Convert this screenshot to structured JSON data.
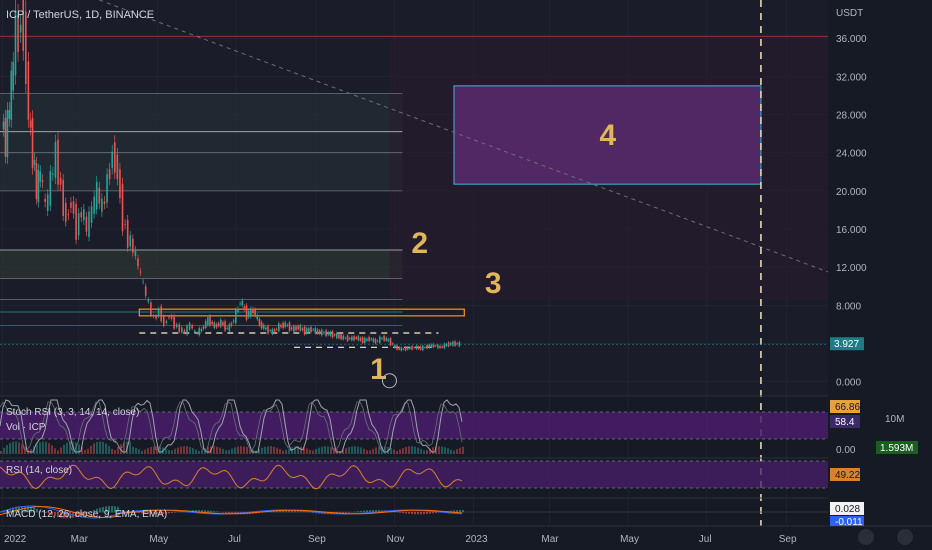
{
  "header": {
    "symbol_title": "ICP / TetherUS, 1D, BINANCE",
    "currency": "USDT"
  },
  "chart_data": [
    {
      "type": "line",
      "title": "ICP / TetherUS, 1D, BINANCE",
      "y_axis_unit": "USDT",
      "ylim": [
        -1.5,
        40
      ],
      "y_ticks": [
        "36.000",
        "32.000",
        "28.000",
        "24.000",
        "20.000",
        "16.000",
        "12.000",
        "8.000",
        "4.000",
        "0.000"
      ],
      "y_tick_values": [
        36,
        32,
        28,
        24,
        20,
        16,
        12,
        8,
        4,
        0
      ],
      "x_ticks": [
        "2022",
        "Mar",
        "May",
        "Jul",
        "Sep",
        "Nov",
        "2023",
        "Mar",
        "May",
        "Jul",
        "Sep"
      ],
      "x_tick_days": [
        0,
        59,
        120,
        181,
        243,
        304,
        365,
        424,
        485,
        546,
        608
      ],
      "xlim_days": [
        -2,
        640
      ],
      "last_price": "3.927",
      "last_price_value": 3.927,
      "price_series": {
        "x_days": [
          0,
          3,
          6,
          9,
          11,
          13,
          15,
          17,
          19,
          21,
          24,
          27,
          30,
          34,
          38,
          42,
          46,
          50,
          54,
          58,
          62,
          66,
          70,
          74,
          78,
          82,
          86,
          90,
          94,
          98,
          102,
          106,
          110,
          114,
          118,
          122,
          126,
          130,
          134,
          138,
          142,
          146,
          150,
          155,
          160,
          165,
          170,
          175,
          180,
          185,
          190,
          195,
          200,
          205,
          210,
          215,
          220,
          225,
          230,
          235,
          240,
          245,
          250,
          255,
          260,
          265,
          270,
          275,
          280,
          285,
          290,
          295,
          300,
          305,
          310,
          315,
          320,
          325,
          330,
          335,
          340,
          345,
          350,
          355
        ],
        "y": [
          27.5,
          25,
          29,
          33,
          38,
          35,
          39,
          37,
          33,
          28,
          24,
          20,
          22,
          18,
          21,
          24,
          20,
          17,
          19,
          16,
          18,
          16,
          18,
          20,
          18,
          21,
          24,
          22,
          17,
          15,
          14,
          12,
          10,
          8,
          6.5,
          7.5,
          6,
          7,
          6,
          5.5,
          5.2,
          6,
          5,
          5.5,
          6.5,
          5.8,
          6.2,
          5.5,
          6.5,
          8.5,
          7,
          7.5,
          6,
          5.5,
          5.2,
          5.8,
          6,
          5.5,
          5.7,
          5.3,
          5.5,
          5.2,
          5.1,
          5,
          4.8,
          4.6,
          4.5,
          4.6,
          4.3,
          4.5,
          4.2,
          4.6,
          4.3,
          3.6,
          3.4,
          3.5,
          3.6,
          3.5,
          3.7,
          3.8,
          3.6,
          3.9,
          4.0,
          3.93
        ]
      },
      "horizontal_levels": [
        36.2,
        30.2,
        26.2,
        24.0,
        20.0,
        13.8,
        10.8,
        8.6,
        7.3,
        5.9
      ],
      "trendline_points": [
        {
          "x_day": 75,
          "y": 40
        },
        {
          "x_day": 640,
          "y": 11.5
        }
      ],
      "projection_line_x_day": 588,
      "zones": [
        {
          "label": "4",
          "x1_day": 350,
          "x2_day": 588,
          "y1": 20.7,
          "y2": 31.0
        }
      ],
      "zone_labels": [
        {
          "label": "1",
          "x_day": 285,
          "y": 0.3
        },
        {
          "label": "2",
          "x_day": 317,
          "y": 13.5
        },
        {
          "label": "3",
          "x_day": 374,
          "y": 9.3
        }
      ],
      "orange_zone": {
        "x1_day": 106,
        "x2_day": 358,
        "y1": 6.9,
        "y2": 7.6
      },
      "support_dashes": [
        {
          "x1_day": 106,
          "x2_day": 338,
          "y": 5.1
        },
        {
          "x1_day": 226,
          "x2_day": 334,
          "y": 3.6
        }
      ]
    },
    {
      "type": "line",
      "title": "Stoch RSI (3, 3, 14, 14, close)",
      "secondary_label": "Vol · ICP",
      "values": [
        66.86,
        58.4
      ],
      "volume_axis": [
        "10M",
        "0.00"
      ],
      "volume_value": "1.593M",
      "ylim": [
        0,
        100
      ]
    },
    {
      "type": "line",
      "title": "RSI (14, close)",
      "values": [
        "49.22"
      ],
      "ylim": [
        0,
        100
      ]
    },
    {
      "type": "line",
      "title": "MACD (12, 26, close, 9, EMA, EMA)",
      "values": [
        "0.028",
        "-0.011"
      ]
    }
  ],
  "colors": {
    "background": "#161a25",
    "grid": "#242836",
    "candle_up": "#26a69a",
    "candle_down": "#ef5350",
    "zone_fill": "#5a2a6e",
    "zone_border": "#3bd5ff",
    "accent_label": "#e0b55c",
    "osc_band": "#4a1d6b",
    "stoch_line": "#9ea3b0",
    "rsi_line": "#d8822c",
    "price_badge": "#1e7c86"
  }
}
